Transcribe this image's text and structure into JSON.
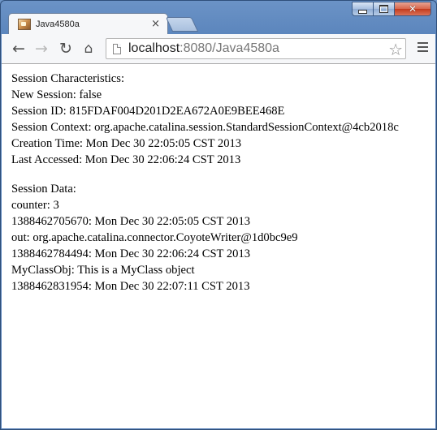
{
  "window": {
    "tab_title": "Java4580a",
    "tab_close": "×"
  },
  "toolbar": {
    "back_icon": "←",
    "forward_icon": "→",
    "reload_icon": "↻",
    "home_icon": "⌂",
    "url_host": "localhost",
    "url_rest": ":8080/Java4580a",
    "star_icon": "☆"
  },
  "content": {
    "characteristics": [
      "Session Characteristics:",
      "New Session: false",
      "Session ID: 815FDAF004D201D2EA672A0E9BEE468E",
      "Session Context: org.apache.catalina.session.StandardSessionContext@4cb2018c",
      "Creation Time: Mon Dec 30 22:05:05 CST 2013",
      "Last Accessed: Mon Dec 30 22:06:24 CST 2013"
    ],
    "data": [
      "Session Data:",
      "counter: 3",
      "1388462705670: Mon Dec 30 22:05:05 CST 2013",
      "out: org.apache.catalina.connector.CoyoteWriter@1d0bc9e9",
      "1388462784494: Mon Dec 30 22:06:24 CST 2013",
      "MyClassObj: This is a MyClass object",
      "1388462831954: Mon Dec 30 22:07:11 CST 2013"
    ]
  }
}
